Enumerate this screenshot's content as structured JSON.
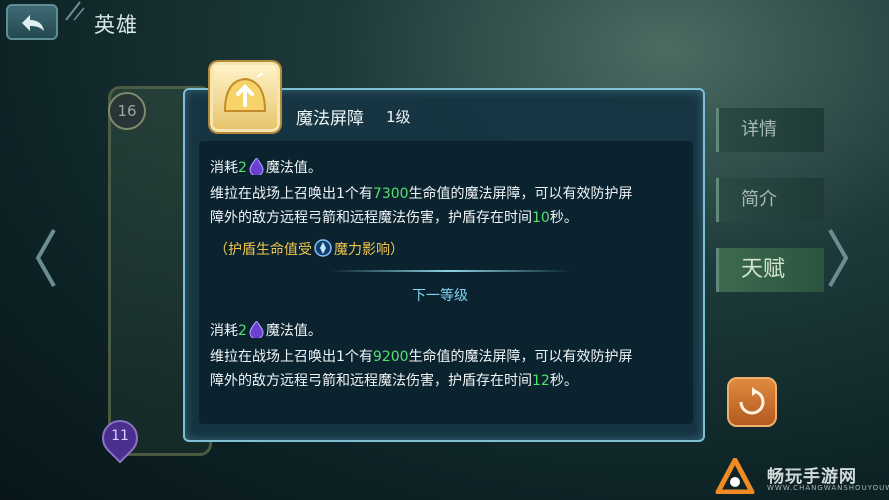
{
  "header": {
    "title": "英雄"
  },
  "background": {
    "level_badge": "16",
    "cost_badge": "11"
  },
  "side_menu": {
    "details": "详情",
    "intro": "简介",
    "talent": "天赋"
  },
  "skill": {
    "name": "魔法屏障",
    "level": "1级",
    "current": {
      "cost_prefix": "消耗",
      "cost_value": "2",
      "cost_suffix": "魔法值。",
      "desc1_a": "维拉在战场上召唤出1个有",
      "desc1_hp": "7300",
      "desc1_b": "生命值的魔法屏障，可以有效防护屏",
      "desc2_a": "障外的敌方远程弓箭和远程魔法伤害，护盾存在时间",
      "desc2_time": "10",
      "desc2_b": "秒。",
      "note_a": "（护盾生命值受",
      "note_b": "魔力影响）"
    },
    "next_level_label": "下一等级",
    "next": {
      "cost_prefix": "消耗",
      "cost_value": "2",
      "cost_suffix": "魔法值。",
      "desc1_a": "维拉在战场上召唤出1个有",
      "desc1_hp": "9200",
      "desc1_b": "生命值的魔法屏障，可以有效防护屏",
      "desc2_a": "障外的敌方远程弓箭和远程魔法伤害，护盾存在时间",
      "desc2_time": "12",
      "desc2_b": "秒。"
    }
  },
  "watermark": {
    "text": "畅玩手游网",
    "sub": "WWW.CHANGWANSHOUYOUWANG"
  },
  "colors": {
    "highlight": "#53e06f",
    "note": "#f0c54c",
    "next_level": "#7fd3f0",
    "popup_border": "#7fbfd6",
    "mana": "#6b3fd0"
  }
}
